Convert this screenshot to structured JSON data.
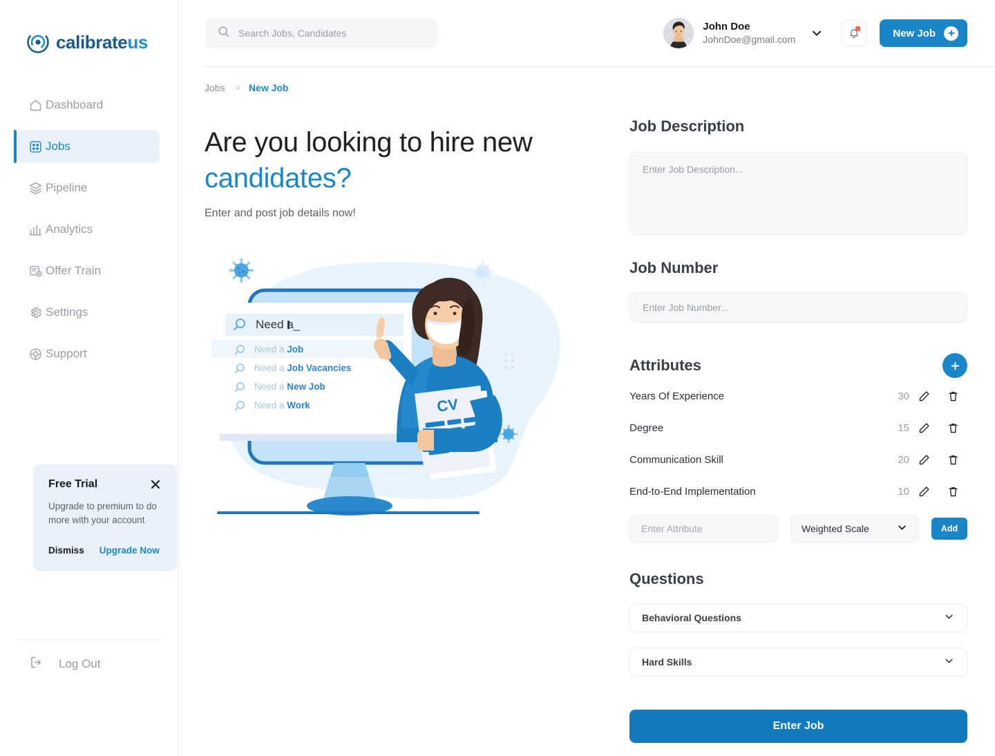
{
  "brand": {
    "name_part1": "calibrate",
    "name_part2": "us",
    "logo_icon": "calibrate-circle-logo",
    "color_dark": "#1c5a87",
    "color_light": "#1f8fd0"
  },
  "theme": {
    "accent": "#1a86c9",
    "accent_dark": "#1179bd",
    "accent_soft_bg": "#e9f2fb",
    "field_bg": "#f6f7f9",
    "notification_dot": "#ef6a4b"
  },
  "sidebar": {
    "items": [
      {
        "label": "Dashboard",
        "icon": "home-icon",
        "active": false
      },
      {
        "label": "Jobs",
        "icon": "grid-icon",
        "active": true
      },
      {
        "label": "Pipeline",
        "icon": "layers-icon",
        "active": false
      },
      {
        "label": "Analytics",
        "icon": "bar-chart-icon",
        "active": false
      },
      {
        "label": "Offer Train",
        "icon": "document-check-icon",
        "active": false
      },
      {
        "label": "Settings",
        "icon": "gear-icon",
        "active": false
      },
      {
        "label": "Support",
        "icon": "lifebuoy-icon",
        "active": false
      }
    ],
    "trial": {
      "title": "Free Trial",
      "body": "Upgrade to premium to do more with your account",
      "dismiss_label": "Dismiss",
      "upgrade_label": "Upgrade Now",
      "close_icon": "close-icon"
    },
    "logout": {
      "label": "Log Out",
      "icon": "logout-icon"
    }
  },
  "topbar": {
    "search": {
      "placeholder": "Search Jobs, Candidates",
      "value": "",
      "icon": "search-icon"
    },
    "user": {
      "name": "John Doe",
      "email": "JohnDoe@gmail.com",
      "avatar": "user-photo-avatar",
      "chevron": "chevron-down-icon"
    },
    "bell": {
      "icon": "bell-icon",
      "has_badge": true
    },
    "new_job": {
      "label": "New Job",
      "icon": "plus-icon"
    }
  },
  "breadcrumb": {
    "parent": "Jobs",
    "separator": "»",
    "current": "New Job"
  },
  "hero": {
    "title_line1": "Are you looking to hire new",
    "title_line2": "candidates?",
    "subtitle": "Enter and post job details now!",
    "illustration": {
      "alt": "woman-with-mask-holding-cv-in-front-of-monitor",
      "search_value": "Need a_",
      "suggestions": [
        {
          "prefix": "Need a ",
          "bold": "Job"
        },
        {
          "prefix": "Need a ",
          "bold": "Job Vacancies"
        },
        {
          "prefix": "Need a ",
          "bold": "New Job"
        },
        {
          "prefix": "Need a ",
          "bold": "Work"
        }
      ],
      "cv_label": "CV"
    }
  },
  "job_description": {
    "title": "Job Description",
    "placeholder": "Enter Job Description...",
    "value": ""
  },
  "job_number": {
    "title": "Job Number",
    "placeholder": "Enter Job Number...",
    "value": ""
  },
  "attributes": {
    "title": "Attributes",
    "add_fab_icon": "plus-icon",
    "rows": [
      {
        "name": "Years Of Experience",
        "value": "30",
        "edit_icon": "pencil-icon",
        "delete_icon": "trash-icon"
      },
      {
        "name": "Degree",
        "value": "15",
        "edit_icon": "pencil-icon",
        "delete_icon": "trash-icon"
      },
      {
        "name": "Communication Skill",
        "value": "20",
        "edit_icon": "pencil-icon",
        "delete_icon": "trash-icon"
      },
      {
        "name": "End-to-End Implementation",
        "value": "10",
        "edit_icon": "pencil-icon",
        "delete_icon": "trash-icon"
      }
    ],
    "new_attribute": {
      "placeholder": "Enter Attribute",
      "value": ""
    },
    "scale_select": {
      "selected": "Weighted Scale",
      "chevron": "chevron-down-icon"
    },
    "add_button": {
      "label": "Add"
    }
  },
  "questions": {
    "title": "Questions",
    "groups": [
      {
        "label": "Behavioral Questions",
        "chevron": "chevron-down-icon",
        "expanded": false
      },
      {
        "label": "Hard Skills",
        "chevron": "chevron-down-icon",
        "expanded": false
      }
    ]
  },
  "submit": {
    "label": "Enter Job"
  }
}
